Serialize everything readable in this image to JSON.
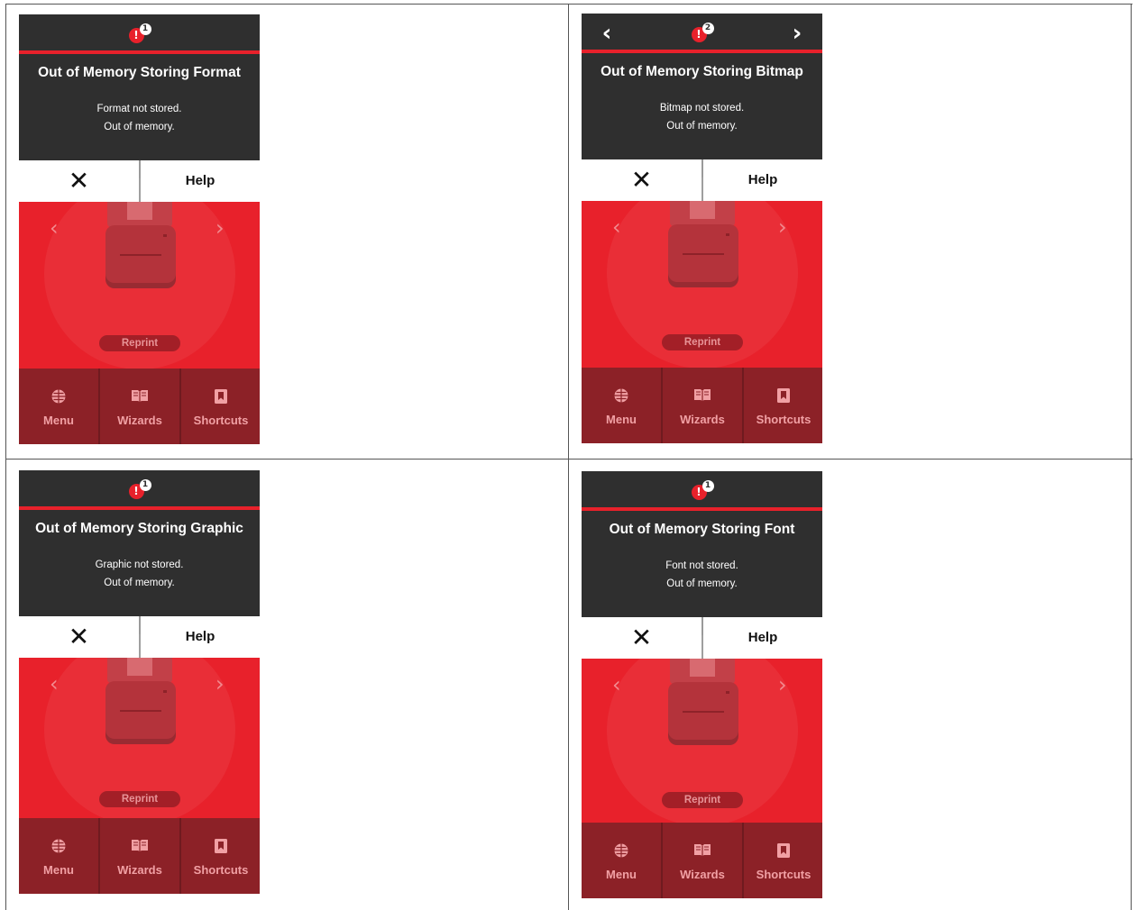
{
  "panels": [
    {
      "alert_count": "1",
      "show_nav": false,
      "title": "Out of Memory Storing Format",
      "message_line1": "Format not stored.",
      "message_line2": "Out of memory.",
      "close_label": "✕",
      "help_label": "Help",
      "reprint_label": "Reprint",
      "nav": [
        {
          "label": "Menu",
          "icon": "globe-icon"
        },
        {
          "label": "Wizards",
          "icon": "book-icon"
        },
        {
          "label": "Shortcuts",
          "icon": "bookmark-icon"
        }
      ]
    },
    {
      "alert_count": "2",
      "show_nav": true,
      "title": "Out of Memory Storing Bitmap",
      "message_line1": "Bitmap not stored.",
      "message_line2": "Out of memory.",
      "close_label": "✕",
      "help_label": "Help",
      "reprint_label": "Reprint",
      "nav": [
        {
          "label": "Menu",
          "icon": "globe-icon"
        },
        {
          "label": "Wizards",
          "icon": "book-icon"
        },
        {
          "label": "Shortcuts",
          "icon": "bookmark-icon"
        }
      ]
    },
    {
      "alert_count": "1",
      "show_nav": false,
      "title": "Out of Memory Storing Graphic",
      "message_line1": "Graphic not stored.",
      "message_line2": "Out of memory.",
      "close_label": "✕",
      "help_label": "Help",
      "reprint_label": "Reprint",
      "nav": [
        {
          "label": "Menu",
          "icon": "globe-icon"
        },
        {
          "label": "Wizards",
          "icon": "book-icon"
        },
        {
          "label": "Shortcuts",
          "icon": "bookmark-icon"
        }
      ]
    },
    {
      "alert_count": "1",
      "show_nav": false,
      "title": "Out of Memory Storing Font",
      "message_line1": "Font not stored.",
      "message_line2": "Out of memory.",
      "close_label": "✕",
      "help_label": "Help",
      "reprint_label": "Reprint",
      "nav": [
        {
          "label": "Menu",
          "icon": "globe-icon"
        },
        {
          "label": "Wizards",
          "icon": "book-icon"
        },
        {
          "label": "Shortcuts",
          "icon": "bookmark-icon"
        }
      ]
    }
  ],
  "colors": {
    "header": "#2f2f2f",
    "accent_red": "#e8212b",
    "nav_bar": "#8c2127"
  }
}
